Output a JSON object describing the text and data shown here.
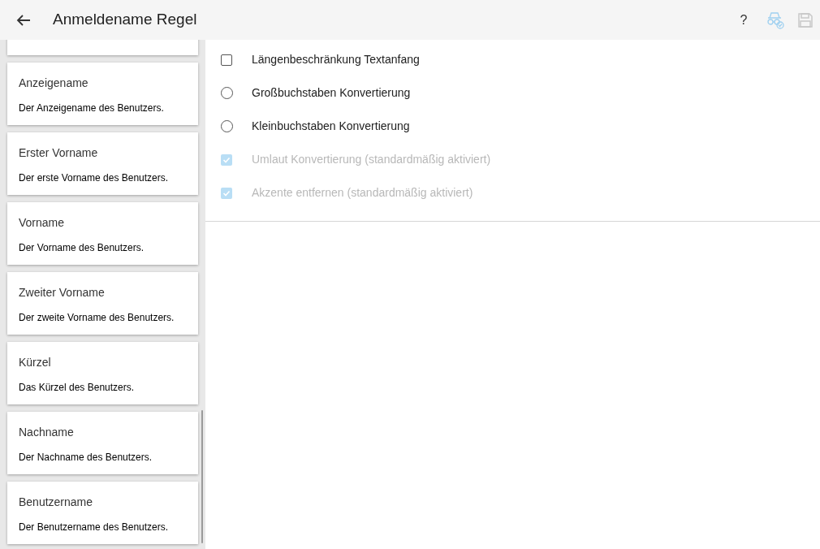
{
  "header": {
    "title": "Anmeldename Regel",
    "help": "?"
  },
  "sidebar": {
    "cards": [
      {
        "title": "Anzeigename",
        "description": "Der Anzeigename des Benutzers."
      },
      {
        "title": "Erster Vorname",
        "description": "Der erste Vorname des Benutzers."
      },
      {
        "title": "Vorname",
        "description": "Der Vorname des Benutzers."
      },
      {
        "title": "Zweiter Vorname",
        "description": "Der zweite Vorname des Benutzers."
      },
      {
        "title": "Kürzel",
        "description": "Das Kürzel des Benutzers."
      },
      {
        "title": "Nachname",
        "description": "Der Nachname des Benutzers."
      },
      {
        "title": "Benutzername",
        "description": "Der Benutzername des Benutzers."
      }
    ]
  },
  "options": [
    {
      "kind": "checkbox",
      "label": "Längenbeschränkung Textanfang",
      "checked": false,
      "disabled": false
    },
    {
      "kind": "radio",
      "label": "Großbuchstaben Konvertierung",
      "checked": false,
      "disabled": false
    },
    {
      "kind": "radio",
      "label": "Kleinbuchstaben Konvertierung",
      "checked": false,
      "disabled": false
    },
    {
      "kind": "checkbox",
      "label": "Umlaut Konvertierung (standardmäßig aktiviert)",
      "checked": true,
      "disabled": true
    },
    {
      "kind": "checkbox",
      "label": "Akzente entfernen (standardmäßig aktiviert)",
      "checked": true,
      "disabled": true
    }
  ]
}
